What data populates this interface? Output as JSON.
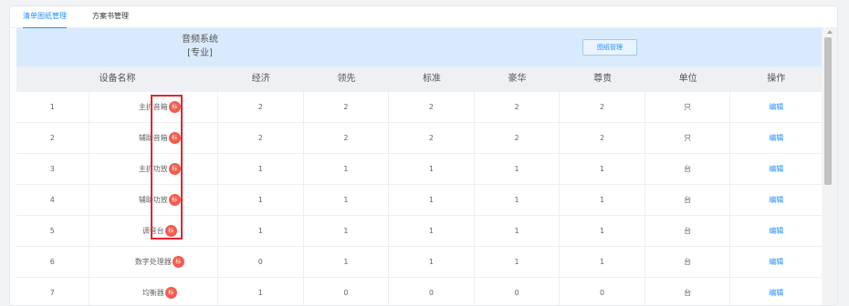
{
  "tabs": [
    {
      "label": "清单图纸管理",
      "active": true
    },
    {
      "label": "方案书管理",
      "active": false
    }
  ],
  "system": {
    "title": "音频系统",
    "subtitle": "[专业]"
  },
  "manage_button": "图纸管理",
  "columns": [
    "设备名称",
    "经济",
    "领先",
    "标准",
    "豪华",
    "尊贵",
    "单位",
    "操作"
  ],
  "badge_text": "标",
  "rows": [
    {
      "idx": "1",
      "name": "主扩音箱",
      "v": [
        "2",
        "2",
        "2",
        "2",
        "2"
      ],
      "unit": "只",
      "op": "编辑"
    },
    {
      "idx": "2",
      "name": "辅助音箱",
      "v": [
        "2",
        "2",
        "2",
        "2",
        "2"
      ],
      "unit": "只",
      "op": "编辑"
    },
    {
      "idx": "3",
      "name": "主扩功放",
      "v": [
        "1",
        "1",
        "1",
        "1",
        "1"
      ],
      "unit": "台",
      "op": "编辑"
    },
    {
      "idx": "4",
      "name": "辅助功放",
      "v": [
        "1",
        "1",
        "1",
        "1",
        "1"
      ],
      "unit": "台",
      "op": "编辑"
    },
    {
      "idx": "5",
      "name": "调音台",
      "v": [
        "1",
        "1",
        "1",
        "1",
        "1"
      ],
      "unit": "台",
      "op": "编辑"
    },
    {
      "idx": "6",
      "name": "数字处理器",
      "v": [
        "0",
        "1",
        "1",
        "1",
        "1"
      ],
      "unit": "台",
      "op": "编辑"
    },
    {
      "idx": "7",
      "name": "均衡器",
      "v": [
        "1",
        "0",
        "0",
        "0",
        "0"
      ],
      "unit": "台",
      "op": "编辑"
    }
  ],
  "colors": {
    "accent": "#1f8fff",
    "badge": "#f25c4f",
    "highlight": "#e0262f",
    "header_bg": "#d9eafc"
  }
}
